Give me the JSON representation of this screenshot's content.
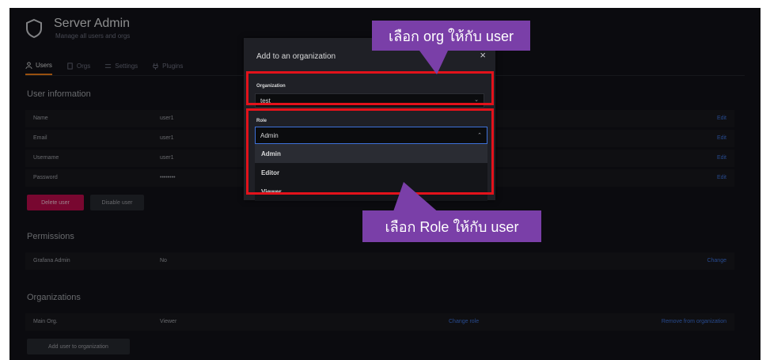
{
  "header": {
    "title": "Server Admin",
    "subtitle": "Manage all users and orgs",
    "icon": "shield-icon"
  },
  "tabs": [
    {
      "label": "Users",
      "icon": "user-icon",
      "active": true
    },
    {
      "label": "Orgs",
      "icon": "building-icon",
      "active": false
    },
    {
      "label": "Settings",
      "icon": "sliders-icon",
      "active": false
    },
    {
      "label": "Plugins",
      "icon": "plug-icon",
      "active": false
    }
  ],
  "user_info": {
    "title": "User information",
    "rows": [
      {
        "label": "Name",
        "value": "user1",
        "action": "Edit"
      },
      {
        "label": "Email",
        "value": "user1",
        "action": "Edit"
      },
      {
        "label": "Username",
        "value": "user1",
        "action": "Edit"
      },
      {
        "label": "Password",
        "value": "••••••••",
        "action": "Edit"
      }
    ],
    "delete_label": "Delete user",
    "disable_label": "Disable user"
  },
  "permissions": {
    "title": "Permissions",
    "row": {
      "label": "Grafana Admin",
      "value": "No",
      "action": "Change"
    }
  },
  "organizations": {
    "title": "Organizations",
    "row": {
      "label": "Main Org.",
      "value": "Viewer",
      "change_role": "Change role",
      "remove": "Remove from organization"
    },
    "add_label": "Add user to organization"
  },
  "modal": {
    "title": "Add to an organization",
    "close": "×",
    "org_label": "Organization",
    "org_value": "test",
    "role_label": "Role",
    "role_value": "Admin",
    "role_options": [
      "Admin",
      "Editor",
      "Viewer"
    ]
  },
  "callouts": {
    "org": "เลือก org ให้กับ user",
    "role": "เลือก Role ให้กับ user"
  },
  "colors": {
    "accent": "#eb7b18",
    "danger": "#d10e5c",
    "link": "#3d71d9",
    "callout": "#7a3fa8",
    "highlight": "#e3121b"
  }
}
